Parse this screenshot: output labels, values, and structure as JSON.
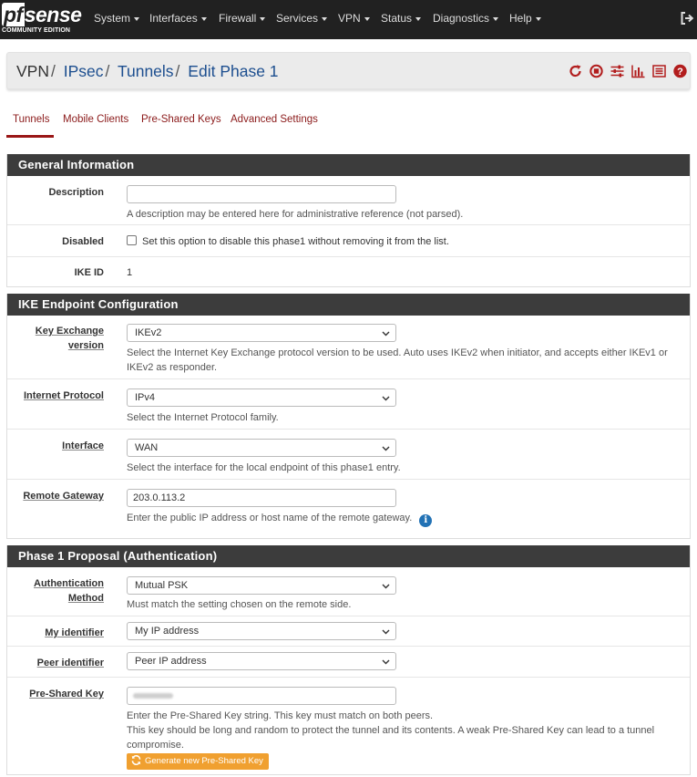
{
  "brand": {
    "logo_pf": "pf",
    "logo_rest": "sense",
    "edition": "COMMUNITY EDITION"
  },
  "nav": {
    "items": [
      "System",
      "Interfaces",
      "Firewall",
      "Services",
      "VPN",
      "Status",
      "Diagnostics",
      "Help"
    ],
    "logout_icon": "sign-out-icon"
  },
  "breadcrumb": {
    "root": "VPN",
    "l1": "IPsec",
    "l2": "Tunnels",
    "current": "Edit Phase 1",
    "separator": "/"
  },
  "header_icons": [
    "restart-icon",
    "stop-icon",
    "sliders-icon",
    "chart-icon",
    "log-icon",
    "help-icon"
  ],
  "tabs": [
    "Tunnels",
    "Mobile Clients",
    "Pre-Shared Keys",
    "Advanced Settings"
  ],
  "sections": {
    "general": {
      "title": "General Information",
      "description": {
        "label": "Description",
        "value": "",
        "help": "A description may be entered here for administrative reference (not parsed)."
      },
      "disabled": {
        "label": "Disabled",
        "checked": false,
        "text": "Set this option to disable this phase1 without removing it from the list."
      },
      "ikeid": {
        "label": "IKE ID",
        "value": "1"
      }
    },
    "endpoint": {
      "title": "IKE Endpoint Configuration",
      "key_exchange": {
        "label_l1": "Key Exchange",
        "label_l2": "version",
        "value": "IKEv2",
        "help_l1": "Select the Internet Key Exchange protocol version to be used. Auto uses IKEv2 when initiator, and accepts either IKEv1 or",
        "help_l2": "IKEv2 as responder."
      },
      "protocol": {
        "label": "Internet Protocol",
        "value": "IPv4",
        "help": "Select the Internet Protocol family."
      },
      "interface": {
        "label": "Interface",
        "value": "WAN",
        "help": "Select the interface for the local endpoint of this phase1 entry."
      },
      "remote_gw": {
        "label": "Remote Gateway",
        "value": "203.0.113.2",
        "help": "Enter the public IP address or host name of the remote gateway."
      }
    },
    "proposal": {
      "title": "Phase 1 Proposal (Authentication)",
      "auth_method": {
        "label_l1": "Authentication",
        "label_l2": "Method",
        "value": "Mutual PSK",
        "help": "Must match the setting chosen on the remote side."
      },
      "my_id": {
        "label": "My identifier",
        "value": "My IP address"
      },
      "peer_id": {
        "label": "Peer identifier",
        "value": "Peer IP address"
      },
      "psk": {
        "label": "Pre-Shared Key",
        "help_l1": "Enter the Pre-Shared Key string. This key must match on both peers.",
        "help_l2": "This key should be long and random to protect the tunnel and its contents. A weak Pre-Shared Key can lead to a tunnel",
        "help_l3": "compromise.",
        "button": "Generate new Pre-Shared Key"
      }
    }
  },
  "colors": {
    "nav_bg": "#212121",
    "section_bg": "#3c3c3c",
    "link": "#1c4e8f",
    "tab": "#8b1a1a",
    "icon_red": "#b21d1d",
    "button": "#f0a030",
    "info": "#2272b5"
  }
}
